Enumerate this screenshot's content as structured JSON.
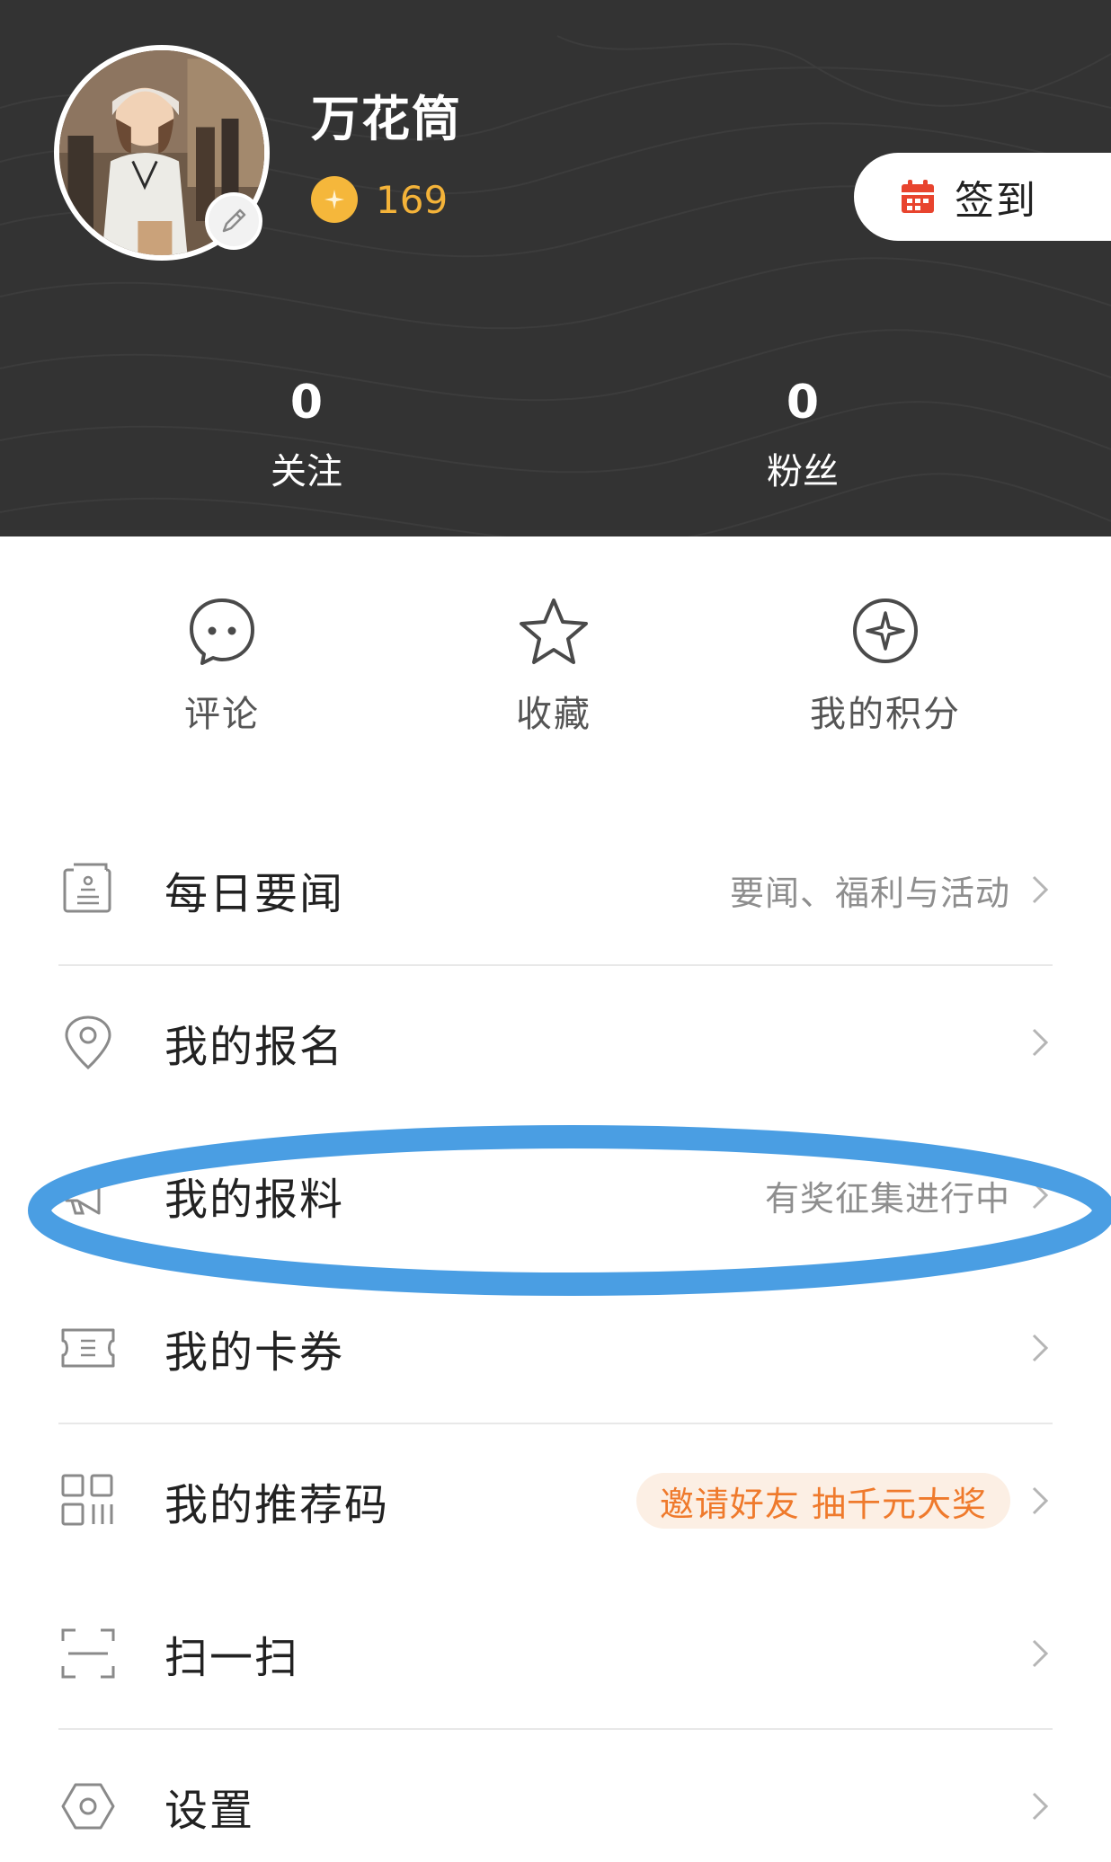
{
  "profile": {
    "username": "万花筒",
    "coins": "169"
  },
  "checkin": {
    "label": "签到"
  },
  "stats": [
    {
      "value": "0",
      "label": "关注"
    },
    {
      "value": "0",
      "label": "粉丝"
    }
  ],
  "quick_actions": [
    {
      "label": "评论",
      "icon": "comment-bubble-icon"
    },
    {
      "label": "收藏",
      "icon": "star-icon"
    },
    {
      "label": "我的积分",
      "icon": "points-sparkle-icon"
    }
  ],
  "menu": [
    {
      "title": "每日要闻",
      "hint": "要闻、福利与活动",
      "icon": "news-icon"
    },
    {
      "title": "我的报名",
      "hint": "",
      "icon": "location-pin-icon"
    },
    {
      "title": "我的报料",
      "hint": "有奖征集进行中",
      "icon": "megaphone-icon"
    },
    {
      "title": "我的卡券",
      "hint": "",
      "icon": "ticket-icon"
    },
    {
      "title": "我的推荐码",
      "hint": "邀请好友  抽千元大奖",
      "icon": "qr-code-icon"
    },
    {
      "title": "扫一扫",
      "hint": "",
      "icon": "scan-icon"
    },
    {
      "title": "设置",
      "hint": "",
      "icon": "settings-hexagon-icon"
    }
  ],
  "colors": {
    "header_bg": "#333333",
    "coin": "#f5b73b",
    "accent_red": "#e8442e",
    "promo_text": "#ef7a2c",
    "promo_bg": "#fcefe4",
    "annotation_ellipse": "#4a9ee3"
  }
}
